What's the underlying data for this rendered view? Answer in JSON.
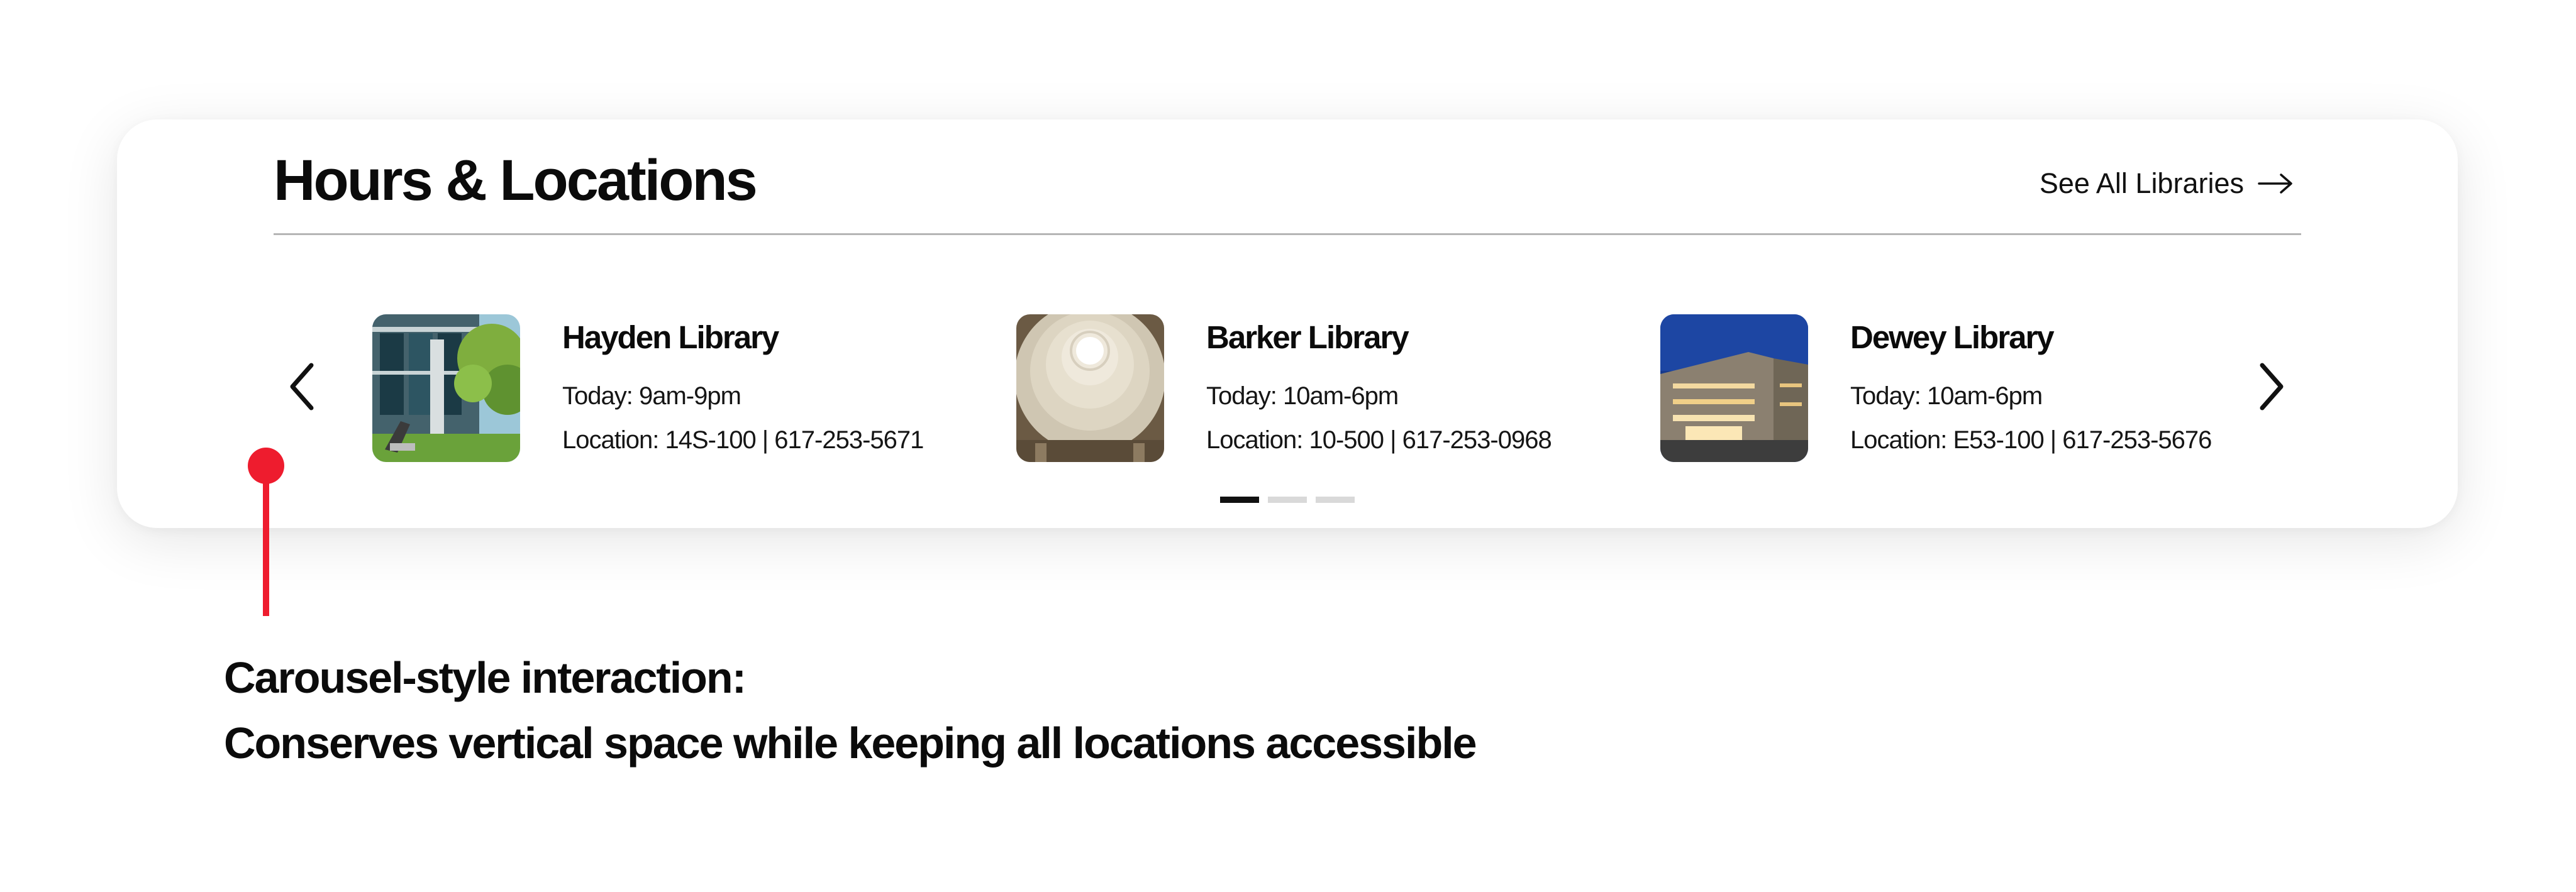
{
  "section": {
    "title": "Hours & Locations",
    "see_all_label": "See All Libraries"
  },
  "libraries": [
    {
      "name": "Hayden Library",
      "hours": "Today: 9am-9pm",
      "location": "Location: 14S-100  | 617-253-5671"
    },
    {
      "name": "Barker Library",
      "hours": "Today: 10am-6pm",
      "location": "Location: 10-500  | 617-253-0968"
    },
    {
      "name": "Dewey Library",
      "hours": "Today: 10am-6pm",
      "location": "Location: E53-100  | 617-253-5676"
    }
  ],
  "pagination": {
    "pages": 3,
    "active_page": 1
  },
  "annotation": {
    "line1": "Carousel-style interaction:",
    "line2": "Conserves vertical space while keeping all locations accessible"
  },
  "icons": {
    "prev": "chevron-left-icon",
    "next": "chevron-right-icon",
    "see_all": "arrow-right-icon"
  },
  "colors": {
    "accent": "#ee1c2e",
    "text": "#0b0b0b",
    "divider": "#b5b5b5",
    "dot_active": "#111111",
    "dot_inactive": "#d9d9d9"
  }
}
